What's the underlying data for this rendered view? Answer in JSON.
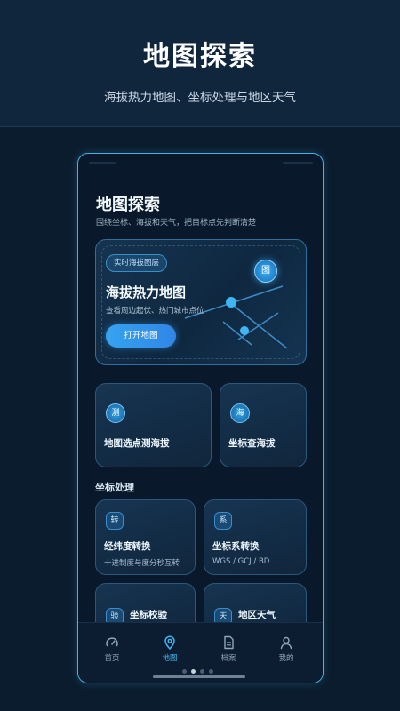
{
  "hero": {
    "title": "地图探索",
    "subtitle": "海拔热力地图、坐标处理与地区天气"
  },
  "screen": {
    "title": "地图探索",
    "subtitle": "围绕坐标、海拔和天气，把目标点先判断清楚"
  },
  "map_card": {
    "badge": "实时海拔图层",
    "title": "海拔热力地图",
    "description": "查看周边起伏、热门城市点位",
    "button": "打开地图",
    "icon_char": "图"
  },
  "quick_tiles": [
    {
      "icon_char": "测",
      "label": "地图选点测海拔"
    },
    {
      "icon_char": "海",
      "label": "坐标查海拔"
    }
  ],
  "coordinate_section": {
    "title": "坐标处理",
    "items": [
      {
        "icon_char": "转",
        "title": "经纬度转换",
        "desc": "十进制度与度分秒互转"
      },
      {
        "icon_char": "系",
        "title": "坐标系转换",
        "desc": "WGS / GCJ / BD"
      },
      {
        "icon_char": "验",
        "title": "坐标校验",
        "desc": ""
      },
      {
        "icon_char": "天",
        "title": "地区天气",
        "desc": ""
      }
    ]
  },
  "tabbar": {
    "items": [
      {
        "label": "首页",
        "icon": "gauge-icon",
        "active": false
      },
      {
        "label": "地图",
        "icon": "map-pin-icon",
        "active": true
      },
      {
        "label": "档案",
        "icon": "document-icon",
        "active": false
      },
      {
        "label": "我的",
        "icon": "user-icon",
        "active": false
      }
    ]
  },
  "pager": {
    "count": 4,
    "current": 1
  },
  "colors": {
    "accent": "#41b4f2",
    "background": "#0b1c2e",
    "phone_border": "#4ab2e2"
  }
}
